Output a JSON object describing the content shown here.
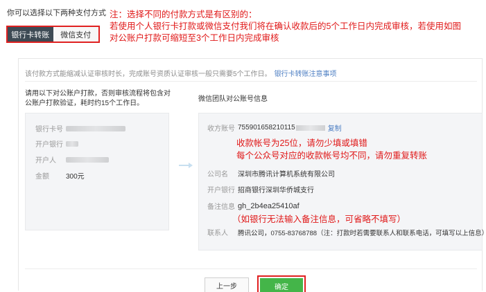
{
  "intro": "你可以选择以下两种支付方式",
  "tabs": [
    {
      "label": "银行卡转账"
    },
    {
      "label": "微信支付"
    }
  ],
  "note": {
    "line1": "注：选择不同的付款方式是有区别的：",
    "line2": "若使用个人银行卡打款或微信支付我们将在确认收款后的5个工作日内完成审核，若使用如图",
    "line3": "对公账户打款可缩短至3个工作日内完成审核"
  },
  "tip": {
    "text": "该付款方式能缩减认证审核时长，完成账号资质认证审核一般只需要5个工作日。",
    "link": "银行卡转账注意事项"
  },
  "left": {
    "desc": "请用以下对公账户打款，否则审核流程将包含对公账户打款验证，耗时约15个工作日。",
    "fields": [
      {
        "label": "银行卡号",
        "value": ""
      },
      {
        "label": "开户银行",
        "value": ""
      },
      {
        "label": "开户人",
        "value": ""
      },
      {
        "label": "金额",
        "value": "300元"
      }
    ]
  },
  "right": {
    "title": "微信团队对公账号信息",
    "account_label": "收方账号",
    "account_value": "755901658210115",
    "copy": "复制",
    "warn1": "收款帐号为25位，请勿少填或填错",
    "warn2": "每个公众号对应的收款帐号均不同，请勿重复转账",
    "company_label": "公司名",
    "company_value": "深圳市腾讯计算机系统有限公司",
    "bank_label": "开户银行",
    "bank_value": "招商银行深圳华侨城支行",
    "memo_label": "备注信息",
    "memo_value": "gh_2b4ea25410af",
    "memo_note": "（如银行无法输入备注信息，可省略不填写）",
    "contact_label": "联系人",
    "contact_value": "腾讯公司，0755-83768788（注：打款时若需要联系人和联系电话，可填写以上信息）"
  },
  "buttons": {
    "prev": "上一步",
    "ok": "确定"
  },
  "colors": {
    "accent_red": "#e01818",
    "tab_active": "#3d4a54",
    "confirm_green": "#44b549",
    "link_blue": "#4e7fc3"
  }
}
